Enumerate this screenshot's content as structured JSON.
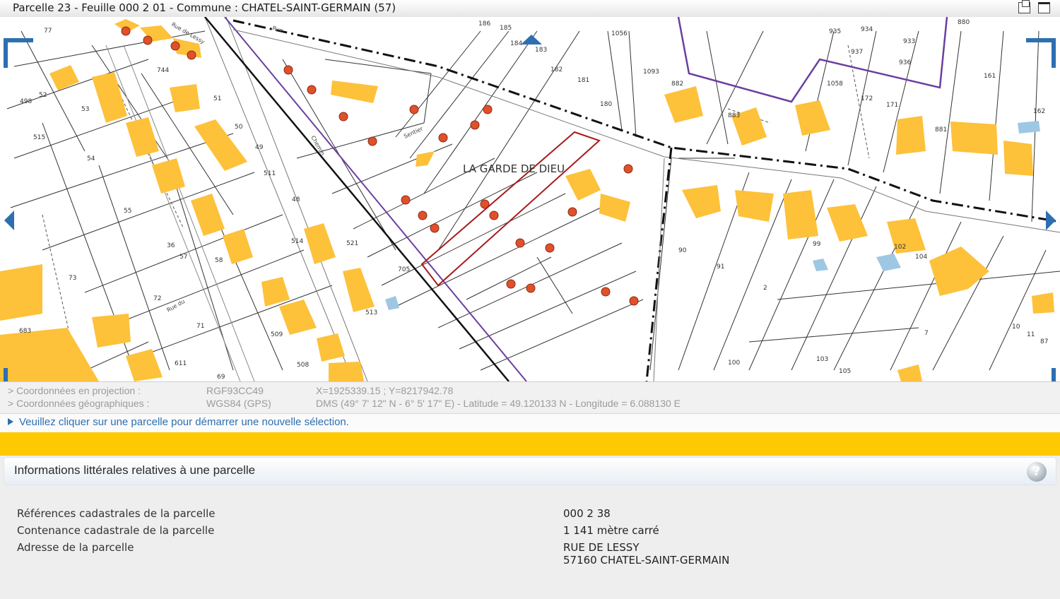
{
  "window": {
    "title": "Parcelle 23 - Feuille 000 2 01 - Commune : CHATEL-SAINT-GERMAIN (57)"
  },
  "map": {
    "locality_label": "LA GARDE DE DIEU",
    "colors": {
      "building": "#fdc13a",
      "selection_outline": "#a81a1a",
      "commune_boundary": "#6a3fa0",
      "parcel_marker": "#e0502a",
      "water_building": "#9ec7e3",
      "nav_accent": "#2d6fb1"
    },
    "parcel_numbers": [
      "77",
      "744",
      "52",
      "498",
      "53",
      "515",
      "54",
      "55",
      "51",
      "50",
      "49",
      "511",
      "48",
      "36",
      "57",
      "58",
      "73",
      "72",
      "71",
      "683",
      "611",
      "69",
      "514",
      "521",
      "509",
      "508",
      "513",
      "705",
      "186",
      "185",
      "184",
      "183",
      "182",
      "181",
      "180",
      "1056",
      "1093",
      "882",
      "883",
      "935",
      "934",
      "933",
      "937",
      "936",
      "880",
      "1058",
      "172",
      "171",
      "161",
      "162",
      "881",
      "90",
      "91",
      "2",
      "99",
      "102",
      "104",
      "7",
      "10",
      "11",
      "87",
      "100",
      "103",
      "105"
    ],
    "road_labels": [
      "Rue de Lessy",
      "Rue",
      "Chemin",
      "Sentier",
      "Rue du"
    ]
  },
  "coordinates": {
    "projection": {
      "label": "> Coordonnées en projection :",
      "system": "RGF93CC49",
      "value": "X=1925339.15 ; Y=8217942.78"
    },
    "geographic": {
      "label": "> Coordonnées géographiques :",
      "system": "WGS84 (GPS)",
      "value": "DMS (49° 7' 12\" N - 6° 5' 17\" E) - Latitude = 49.120133 N - Longitude = 6.088130 E"
    }
  },
  "notice": "Veuillez cliquer sur une parcelle pour démarrer une nouvelle sélection.",
  "info": {
    "title": "Informations littérales relatives à une parcelle",
    "help_icon_glyph": "?",
    "rows": [
      {
        "label": "Références cadastrales de la parcelle",
        "value": "000 2 38"
      },
      {
        "label": "Contenance cadastrale de la parcelle",
        "value": "1 141 mètre carré"
      },
      {
        "label": "Adresse de la parcelle",
        "value_line1": "RUE DE LESSY",
        "value_line2": "57160 CHATEL-SAINT-GERMAIN"
      }
    ]
  }
}
